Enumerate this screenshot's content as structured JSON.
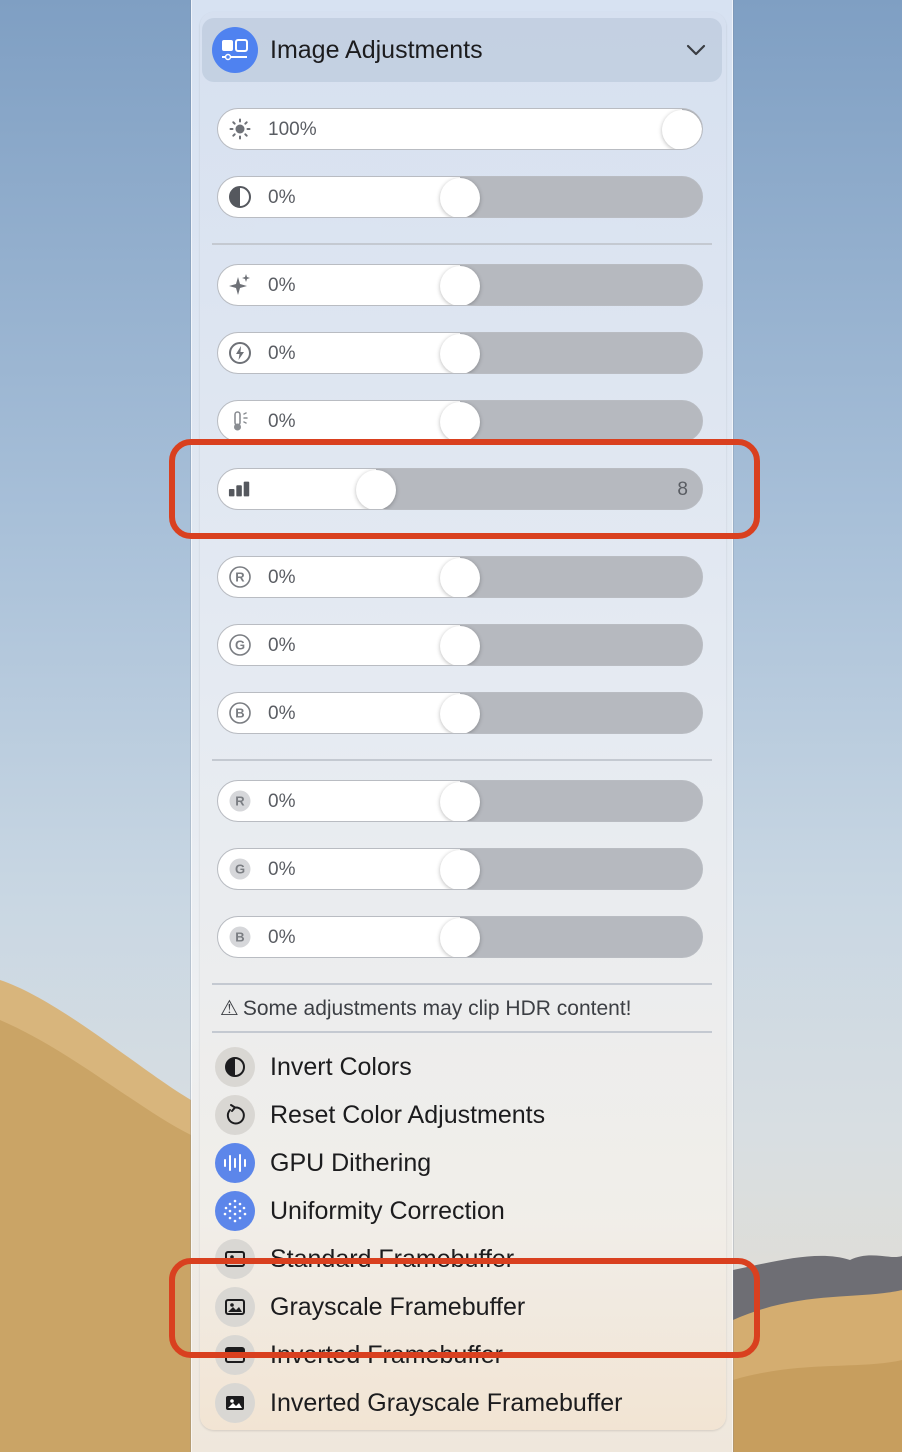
{
  "header": {
    "title": "Image Adjustments",
    "icon": "display-settings-icon",
    "chevron": "chevron-down-icon"
  },
  "sliders_group1": [
    {
      "name": "brightness",
      "icon": "sun-icon",
      "label": "100%",
      "level": 1.0
    },
    {
      "name": "contrast",
      "icon": "contrast-icon",
      "label": "0%",
      "level": 0.5
    }
  ],
  "sliders_group2": [
    {
      "name": "sparkle",
      "icon": "sparkles-icon",
      "label": "0%",
      "level": 0.5
    },
    {
      "name": "bolt",
      "icon": "bolt-icon",
      "label": "0%",
      "level": 0.5
    },
    {
      "name": "temperature",
      "icon": "thermometer-sun-icon",
      "label": "0%",
      "level": 0.5
    },
    {
      "name": "bit-depth",
      "icon": "chart-bars-icon",
      "label": "",
      "value": "8",
      "level": 0.31
    },
    {
      "name": "red-gain",
      "icon": "circle-r-icon",
      "label": "0%",
      "level": 0.5
    },
    {
      "name": "green-gain",
      "icon": "circle-g-icon",
      "label": "0%",
      "level": 0.5
    },
    {
      "name": "blue-gain",
      "icon": "circle-b-icon",
      "label": "0%",
      "level": 0.5
    }
  ],
  "sliders_group3": [
    {
      "name": "red-offset",
      "icon": "filled-r-icon",
      "label": "0%",
      "level": 0.5
    },
    {
      "name": "green-offset",
      "icon": "filled-g-icon",
      "label": "0%",
      "level": 0.5
    },
    {
      "name": "blue-offset",
      "icon": "filled-b-icon",
      "label": "0%",
      "level": 0.5
    }
  ],
  "warning": {
    "icon": "warning-triangle-icon",
    "text": "Some adjustments may clip HDR content!"
  },
  "menu": [
    {
      "label": "Invert Colors",
      "icon": "invert-icon",
      "active": false
    },
    {
      "label": "Reset Color Adjustments",
      "icon": "reset-icon",
      "active": false
    },
    {
      "label": "GPU Dithering",
      "icon": "dither-waveform-icon",
      "active": true
    },
    {
      "label": "Uniformity Correction",
      "icon": "dots-grid-icon",
      "active": true
    },
    {
      "label": "Standard Framebuffer",
      "icon": "framebuffer-icon",
      "active": false
    },
    {
      "label": "Grayscale Framebuffer",
      "icon": "photo-icon",
      "active": false
    },
    {
      "label": "Inverted Framebuffer",
      "icon": "framebuffer-inverted-icon",
      "active": false
    },
    {
      "label": "Inverted Grayscale Framebuffer",
      "icon": "photo-filled-icon",
      "active": false
    }
  ],
  "colors": {
    "accent": "#4f82f0",
    "highlight": "#d9401f",
    "slider_track": "#b6b9bf",
    "slider_fill": "#ffffff"
  }
}
